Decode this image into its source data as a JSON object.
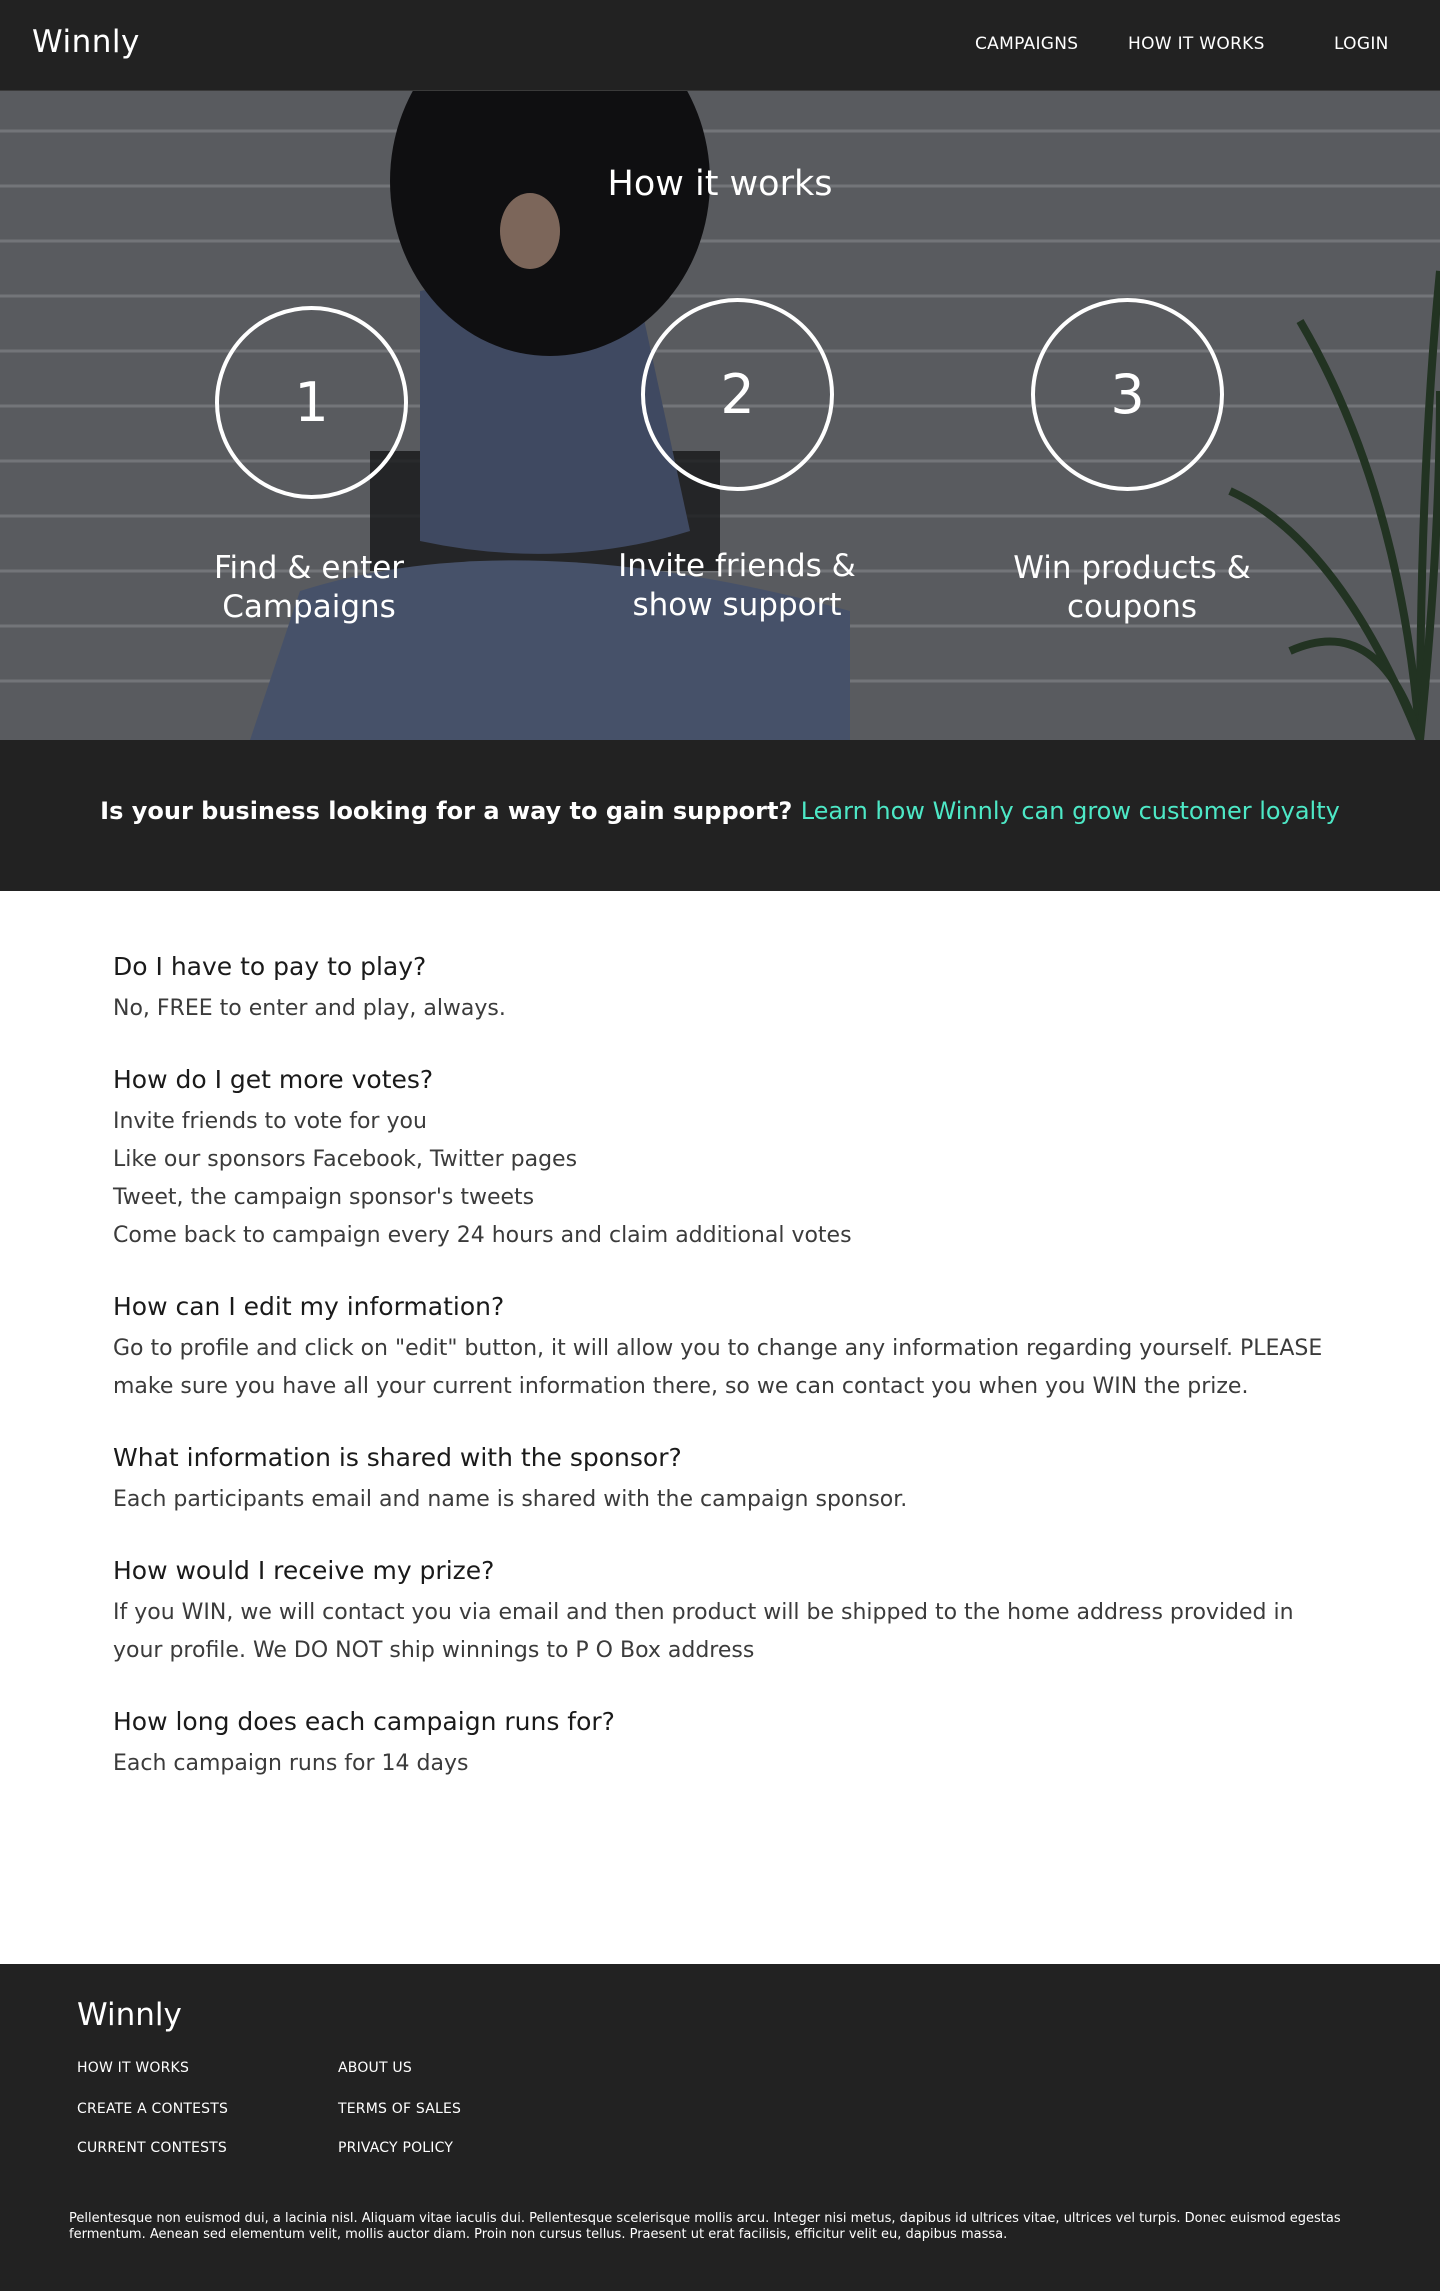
{
  "header": {
    "brand": "Winnly",
    "nav": {
      "campaigns": "CAMPAIGNS",
      "how_it_works": "HOW IT WORKS",
      "login": "LOGIN"
    }
  },
  "hero": {
    "title": "How it works",
    "steps": [
      {
        "number": "1",
        "line1": "Find & enter",
        "line2": "Campaigns"
      },
      {
        "number": "2",
        "line1": "Invite friends &",
        "line2": "show support"
      },
      {
        "number": "3",
        "line1": "Win products &",
        "line2": "coupons"
      }
    ]
  },
  "business": {
    "question": "Is your business looking for a way to gain support?",
    "link": "Learn how Winnly can grow customer loyalty"
  },
  "faq": [
    {
      "question": "Do I have to pay to play?",
      "answers": [
        "No, FREE to enter and play, always."
      ]
    },
    {
      "question": "How do I get more votes?",
      "answers": [
        "Invite friends to vote for you",
        "Like our sponsors Facebook, Twitter pages",
        "Tweet, the campaign sponsor's tweets",
        "Come back to campaign every 24 hours and claim additional votes"
      ]
    },
    {
      "question": "How can I edit my information?",
      "answers": [
        "Go to profile and click on \"edit\" button, it will allow you to change any information regarding yourself. PLEASE make sure you have all your current information there, so we can contact you when you WIN the prize."
      ]
    },
    {
      "question": "What information is shared with the sponsor?",
      "answers": [
        "Each participants email and name is shared with the campaign sponsor."
      ]
    },
    {
      "question": "How would I receive my prize?",
      "answers": [
        "If you WIN, we will contact you via email and then product will be shipped to the home address provided in your profile. We DO NOT ship winnings to P O Box address"
      ]
    },
    {
      "question": "How long does each campaign runs for?",
      "answers": [
        "Each campaign runs for 14 days"
      ]
    }
  ],
  "footer": {
    "brand": "Winnly",
    "links": {
      "how_it_works": "HOW IT WORKS",
      "create_contests": "CREATE A  CONTESTS",
      "current_contests": "CURRENT CONTESTS",
      "about_us": "ABOUT US",
      "terms_of_sales": "TERMS OF SALES",
      "privacy_policy": "PRIVACY POLICY"
    },
    "copy": "Pellentesque non euismod dui, a lacinia nisl. Aliquam vitae iaculis dui. Pellentesque scelerisque mollis arcu. Integer nisi metus, dapibus id ultrices vitae, ultrices vel turpis. Donec euismod egestas fermentum. Aenean sed elementum velit, mollis auctor diam. Proin non cursus tellus. Praesent ut erat facilisis, efficitur velit eu, dapibus massa."
  },
  "colors": {
    "dark_bg": "#222222",
    "accent": "#4de8c6",
    "text_dark": "#1a1a1a"
  },
  "icons": {
    "hero_image": "woman-with-hat-photo"
  }
}
